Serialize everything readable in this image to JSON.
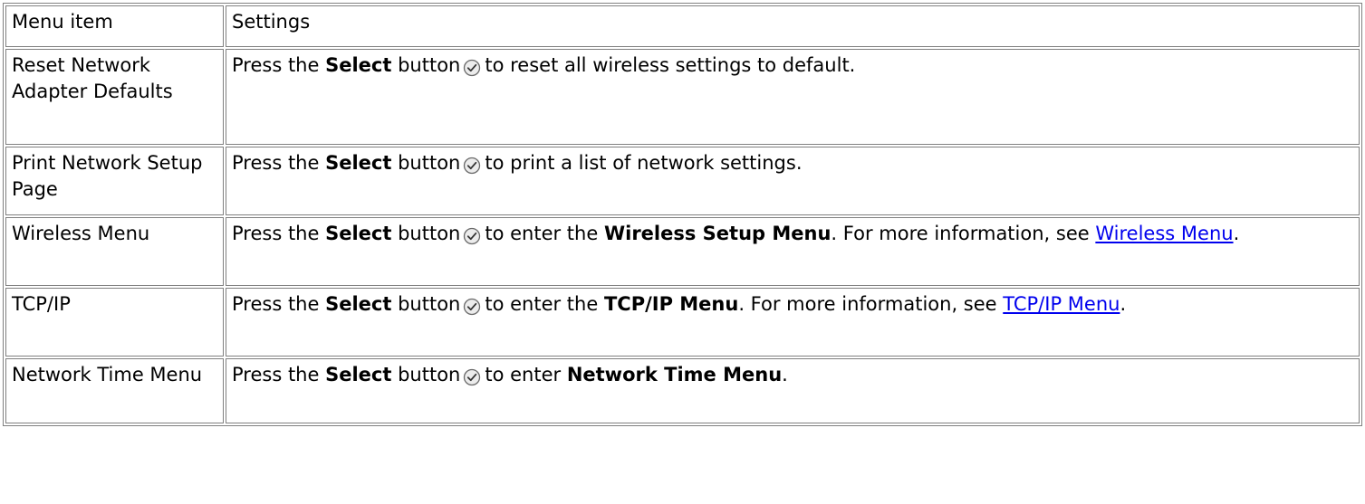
{
  "table": {
    "header": {
      "item": "Menu item",
      "settings": "Settings"
    },
    "rows": [
      {
        "item": "Reset Network Adapter Defaults",
        "press": "Press the",
        "button_word": "Select",
        "button": "button",
        "rest": "to reset all wireless settings to default."
      },
      {
        "item": "Print Network Setup Page",
        "press": "Press the",
        "button_word": "Select",
        "button": "button",
        "rest": "to print a list of network settings."
      },
      {
        "item": "Wireless Menu",
        "press": "Press the",
        "button_word": "Select",
        "button": "button",
        "mid": "to enter the",
        "menu_name": "Wireless Setup Menu",
        "more": ". For more information, see",
        "link": "Wireless Menu",
        "end": "."
      },
      {
        "item": "TCP/IP",
        "press": "Press the",
        "button_word": "Select",
        "button": "button",
        "mid": "to enter the",
        "menu_name": "TCP/IP Menu",
        "more": ". For more information, see",
        "link": "TCP/IP Menu",
        "end": "."
      },
      {
        "item": "Network Time Menu",
        "press": "Press the",
        "button_word": "Select",
        "button": "button",
        "mid": "to enter",
        "menu_name": "Network Time Menu",
        "end": "."
      }
    ]
  },
  "icon": "select-button-checkmark-icon",
  "colors": {
    "border": "#808080",
    "link": "#0000ee",
    "text": "#000000",
    "background": "#ffffff"
  }
}
